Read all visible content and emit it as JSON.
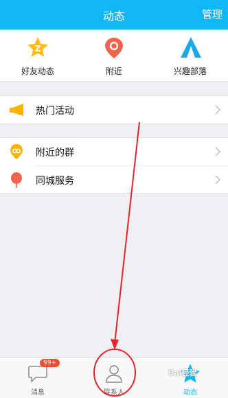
{
  "header": {
    "title": "动态",
    "manage": "管理"
  },
  "quick": {
    "friends": "好友动态",
    "nearby": "附近",
    "tribe": "兴趣部落"
  },
  "list": {
    "hot": "热门活动",
    "nearby_groups": "附近的群",
    "city": "同城服务"
  },
  "tabbar": {
    "messages": "消息",
    "messages_badge": "99+",
    "contacts": "联系人",
    "activity": "动态"
  },
  "watermark": "Bai经验"
}
